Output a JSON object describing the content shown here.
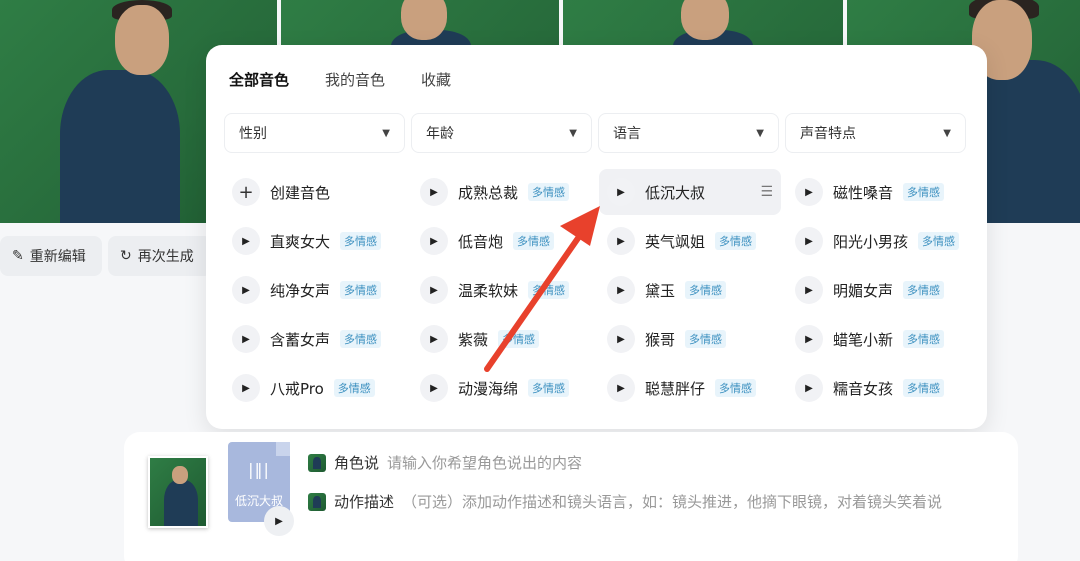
{
  "photos": [
    {
      "name": "photo-1"
    },
    {
      "name": "photo-2"
    },
    {
      "name": "photo-3"
    },
    {
      "name": "photo-4"
    }
  ],
  "actions": {
    "reedit": {
      "label": "重新编辑",
      "icon": "edit-icon"
    },
    "regenerate": {
      "label": "再次生成",
      "icon": "refresh-icon"
    }
  },
  "tabs": [
    "全部音色",
    "我的音色",
    "收藏"
  ],
  "filters": [
    "性别",
    "年龄",
    "语言",
    "声音特点"
  ],
  "tag_label": "多情感",
  "voices": [
    [
      {
        "label": "创建音色",
        "type": "create"
      },
      {
        "label": "成熟总裁",
        "tag": true
      },
      {
        "label": "低沉大叔",
        "selected": true
      },
      {
        "label": "磁性嗓音",
        "tag": true
      }
    ],
    [
      {
        "label": "直爽女大",
        "tag": true
      },
      {
        "label": "低音炮",
        "tag": true
      },
      {
        "label": "英气飒姐",
        "tag": true
      },
      {
        "label": "阳光小男孩",
        "tag": true
      }
    ],
    [
      {
        "label": "纯净女声",
        "tag": true
      },
      {
        "label": "温柔软妹",
        "tag": true
      },
      {
        "label": "黛玉",
        "tag": true
      },
      {
        "label": "明媚女声",
        "tag": true
      }
    ],
    [
      {
        "label": "含蓄女声",
        "tag": true
      },
      {
        "label": "紫薇",
        "tag": true
      },
      {
        "label": "猴哥",
        "tag": true
      },
      {
        "label": "蜡笔小新",
        "tag": true
      }
    ],
    [
      {
        "label": "八戒Pro",
        "tag": true
      },
      {
        "label": "动漫海绵",
        "tag": true
      },
      {
        "label": "聪慧胖仔",
        "tag": true
      },
      {
        "label": "糯音女孩",
        "tag": true
      }
    ]
  ],
  "bottom": {
    "audio_label": "低沉大叔",
    "role_say_label": "角色说",
    "role_say_placeholder": "请输入你希望角色说出的内容",
    "action_label": "动作描述",
    "action_placeholder": "（可选）添加动作描述和镜头语言，如：镜头推进，他摘下眼镜，对着镜头笑着说"
  },
  "colors": {
    "accent_tag": "#3a8fbf",
    "arrow": "#e8412c",
    "photo_bg": "#2f7d45"
  }
}
